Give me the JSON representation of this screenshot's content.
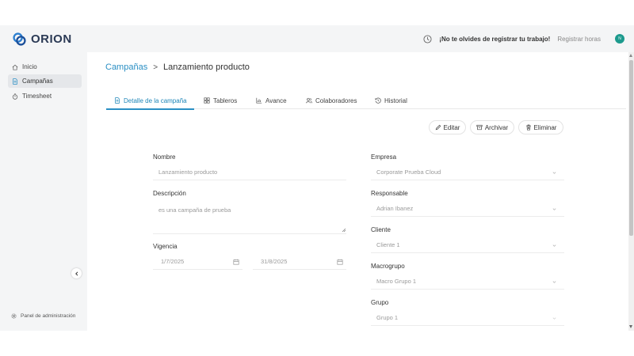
{
  "app": {
    "name": "ORION"
  },
  "header": {
    "reminder": "¡No te olvides de registrar tu trabajo!",
    "register_hours": "Registrar horas",
    "avatar_initial": "N"
  },
  "sidebar": {
    "items": [
      {
        "label": "Inicio",
        "icon": "home-icon"
      },
      {
        "label": "Campañas",
        "icon": "document-icon",
        "active": true
      },
      {
        "label": "Timesheet",
        "icon": "timer-icon"
      }
    ],
    "admin_label": "Panel de administración"
  },
  "breadcrumb": {
    "parent": "Campañas",
    "separator": ">",
    "current": "Lanzamiento producto"
  },
  "tabs": [
    {
      "label": "Detalle de la campaña",
      "icon": "document-icon",
      "active": true
    },
    {
      "label": "Tableros",
      "icon": "grid-icon"
    },
    {
      "label": "Avance",
      "icon": "chart-icon"
    },
    {
      "label": "Colaboradores",
      "icon": "users-icon"
    },
    {
      "label": "Historial",
      "icon": "history-icon"
    }
  ],
  "actions": {
    "edit": "Editar",
    "archive": "Archivar",
    "delete": "Eliminar"
  },
  "form": {
    "nombre": {
      "label": "Nombre",
      "value": "Lanzamiento producto"
    },
    "descripcion": {
      "label": "Descripción",
      "value": "es una campaña de prueba"
    },
    "vigencia": {
      "label": "Vigencia",
      "start": "1/7/2025",
      "end": "31/8/2025"
    },
    "empresa": {
      "label": "Empresa",
      "value": "Corporate Prueba Cloud"
    },
    "responsable": {
      "label": "Responsable",
      "value": "Adrian Ibanez"
    },
    "cliente": {
      "label": "Cliente",
      "value": "Cliente 1"
    },
    "macrogrupo": {
      "label": "Macrogrupo",
      "value": "Macro Grupo 1"
    },
    "grupo": {
      "label": "Grupo",
      "value": "Grupo 1"
    }
  },
  "colors": {
    "accent": "#2a8fc4",
    "avatar": "#1c9a8d",
    "sidebar_bg": "#f4f5f6"
  }
}
